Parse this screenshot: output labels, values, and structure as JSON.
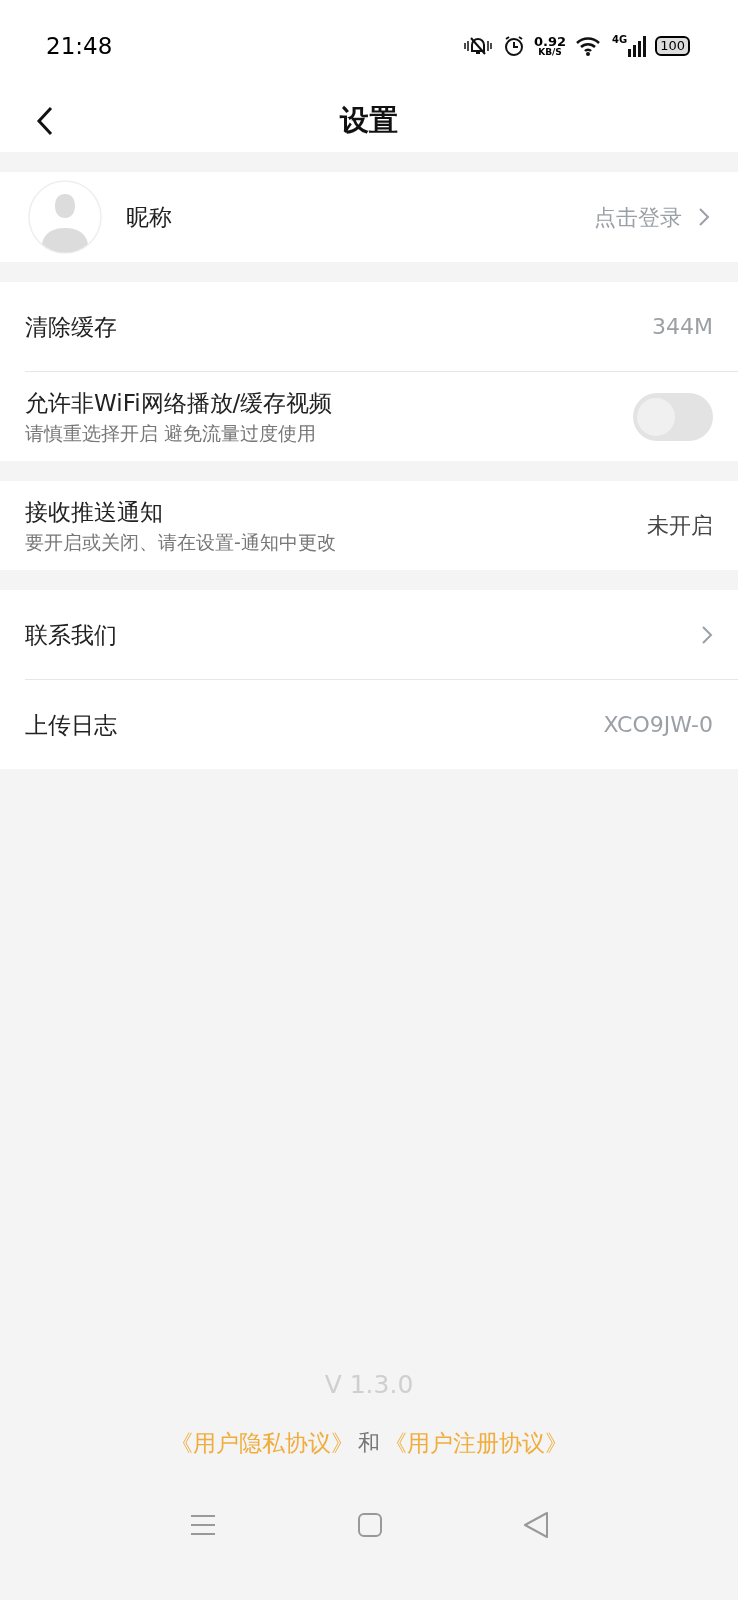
{
  "status_bar": {
    "time": "21:48",
    "speed": "0.92",
    "speed_unit": "KB/S",
    "network": "4G",
    "battery": "100"
  },
  "header": {
    "title": "设置"
  },
  "profile": {
    "name": "昵称",
    "action": "点击登录"
  },
  "sections": [
    [
      {
        "kind": "value",
        "label": "清除缓存",
        "value": "344M",
        "dark": false
      },
      {
        "kind": "toggle",
        "label": "允许非WiFi网络播放/缓存视频",
        "subtitle": "请慎重选择开启 避免流量过度使用",
        "on": false
      }
    ],
    [
      {
        "kind": "value",
        "label": "接收推送通知",
        "subtitle": "要开启或关闭、请在设置-通知中更改",
        "value": "未开启",
        "dark": true
      }
    ],
    [
      {
        "kind": "chevron",
        "label": "联系我们"
      },
      {
        "kind": "value",
        "label": "上传日志",
        "value": "XCO9JW-0",
        "dark": false
      }
    ]
  ],
  "footer": {
    "version": "V 1.3.0",
    "links": [
      {
        "kind": "link",
        "text": "《用户隐私协议》"
      },
      {
        "kind": "text",
        "text": "和"
      },
      {
        "kind": "link",
        "text": "《用户注册协议》"
      }
    ]
  }
}
